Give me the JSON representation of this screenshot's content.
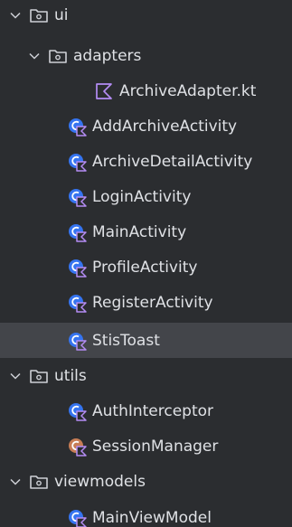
{
  "tree": {
    "items": [
      {
        "label": "ui",
        "kind": "folder",
        "expanded": true
      },
      {
        "label": "adapters",
        "kind": "folder",
        "expanded": true
      },
      {
        "label": "ArchiveAdapter.kt",
        "kind": "kotlin-file"
      },
      {
        "label": "AddArchiveActivity",
        "kind": "kotlin-class"
      },
      {
        "label": "ArchiveDetailActivity",
        "kind": "kotlin-class"
      },
      {
        "label": "LoginActivity",
        "kind": "kotlin-class"
      },
      {
        "label": "MainActivity",
        "kind": "kotlin-class"
      },
      {
        "label": "ProfileActivity",
        "kind": "kotlin-class"
      },
      {
        "label": "RegisterActivity",
        "kind": "kotlin-class"
      },
      {
        "label": "StisToast",
        "kind": "kotlin-class",
        "selected": true
      },
      {
        "label": "utils",
        "kind": "folder",
        "expanded": true
      },
      {
        "label": "AuthInterceptor",
        "kind": "kotlin-class"
      },
      {
        "label": "SessionManager",
        "kind": "kotlin-object"
      },
      {
        "label": "viewmodels",
        "kind": "folder",
        "expanded": true
      },
      {
        "label": "MainViewModel",
        "kind": "kotlin-class"
      }
    ]
  },
  "colors": {
    "background": "#2b2d30",
    "selection": "#43454a",
    "text": "#dfe1e5",
    "class_icon": "#3574f0",
    "object_icon": "#c77d55",
    "kotlin_accent": "#b48cf4",
    "folder_icon": "#ced0d6"
  }
}
